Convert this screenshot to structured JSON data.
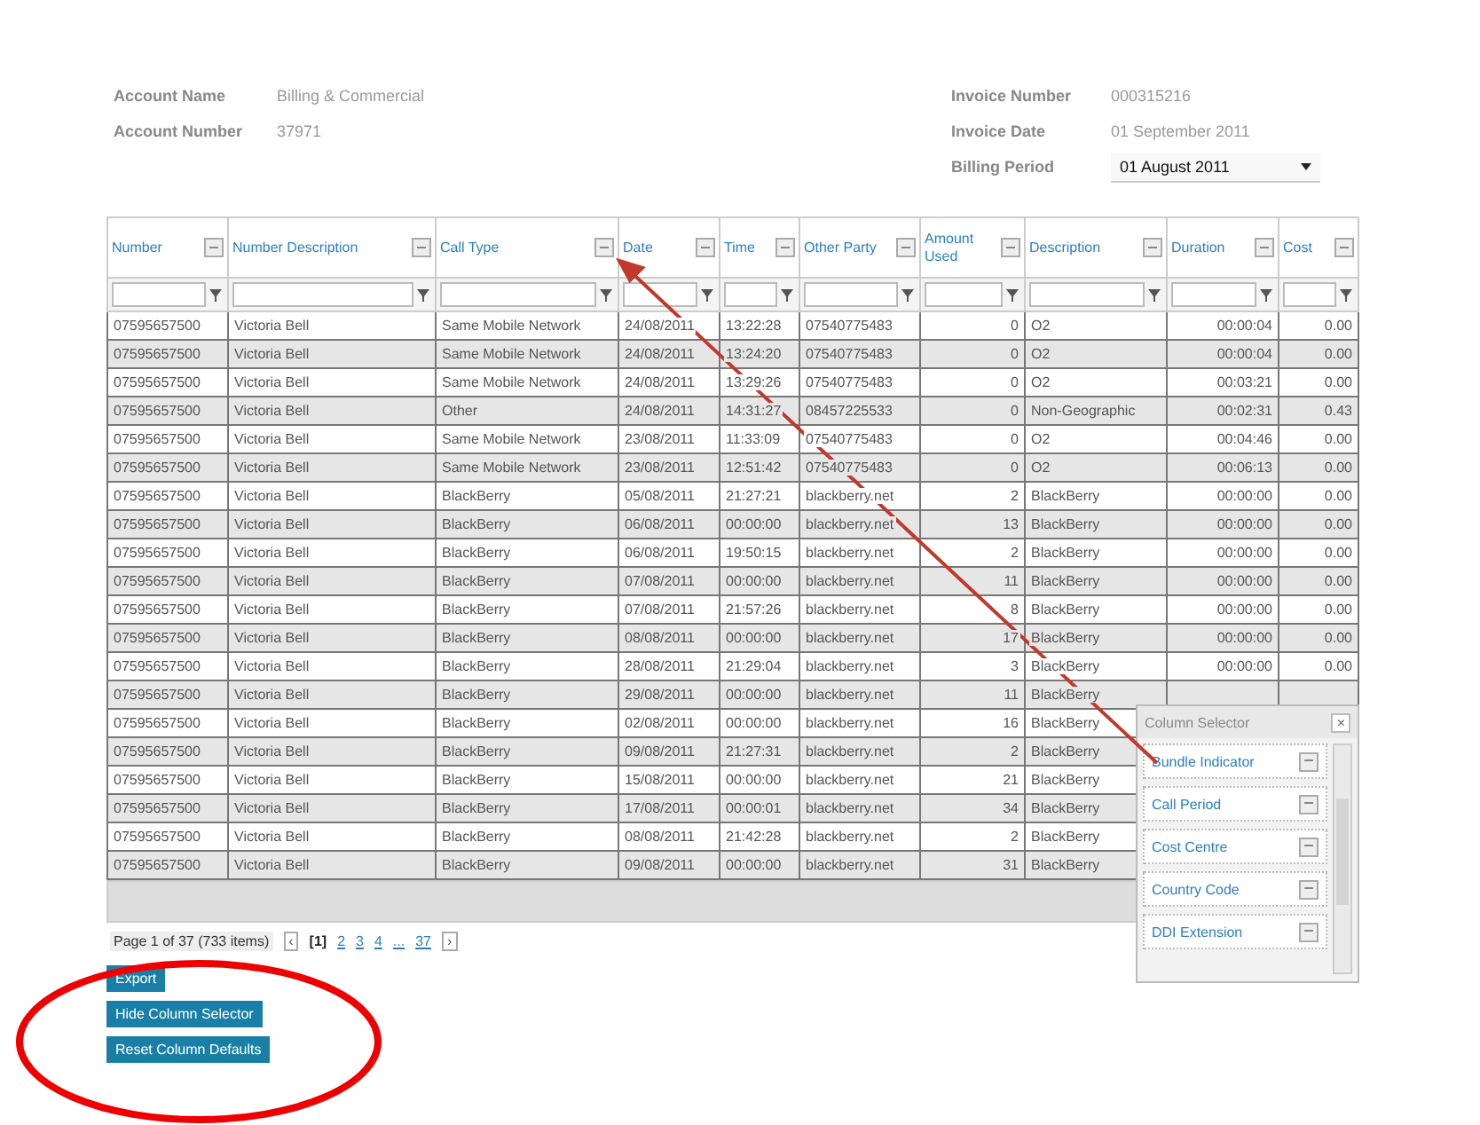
{
  "account": {
    "name_label": "Account Name",
    "name_value": "Billing & Commercial",
    "number_label": "Account Number",
    "number_value": "37971"
  },
  "invoice": {
    "number_label": "Invoice Number",
    "number_value": "000315216",
    "date_label": "Invoice Date",
    "date_value": "01 September 2011",
    "period_label": "Billing Period",
    "period_value": "01 August 2011"
  },
  "grid": {
    "columns": [
      {
        "label": "Number"
      },
      {
        "label": "Number Description"
      },
      {
        "label": "Call Type"
      },
      {
        "label": "Date"
      },
      {
        "label": "Time"
      },
      {
        "label": "Other Party"
      },
      {
        "label": "Amount Used"
      },
      {
        "label": "Description"
      },
      {
        "label": "Duration"
      },
      {
        "label": "Cost"
      }
    ],
    "rows": [
      {
        "cells": [
          "07595657500",
          "Victoria Bell",
          "Same Mobile Network",
          "24/08/2011",
          "13:22:28",
          "07540775483",
          "0",
          "O2",
          "00:00:04",
          "0.00"
        ]
      },
      {
        "cells": [
          "07595657500",
          "Victoria Bell",
          "Same Mobile Network",
          "24/08/2011",
          "13:24:20",
          "07540775483",
          "0",
          "O2",
          "00:00:04",
          "0.00"
        ]
      },
      {
        "cells": [
          "07595657500",
          "Victoria Bell",
          "Same Mobile Network",
          "24/08/2011",
          "13:29:26",
          "07540775483",
          "0",
          "O2",
          "00:03:21",
          "0.00"
        ]
      },
      {
        "cells": [
          "07595657500",
          "Victoria Bell",
          "Other",
          "24/08/2011",
          "14:31:27",
          "08457225533",
          "0",
          "Non-Geographic",
          "00:02:31",
          "0.43"
        ]
      },
      {
        "cells": [
          "07595657500",
          "Victoria Bell",
          "Same Mobile Network",
          "23/08/2011",
          "11:33:09",
          "07540775483",
          "0",
          "O2",
          "00:04:46",
          "0.00"
        ]
      },
      {
        "cells": [
          "07595657500",
          "Victoria Bell",
          "Same Mobile Network",
          "23/08/2011",
          "12:51:42",
          "07540775483",
          "0",
          "O2",
          "00:06:13",
          "0.00"
        ]
      },
      {
        "cells": [
          "07595657500",
          "Victoria Bell",
          "BlackBerry",
          "05/08/2011",
          "21:27:21",
          "blackberry.net",
          "2",
          "BlackBerry",
          "00:00:00",
          "0.00"
        ]
      },
      {
        "cells": [
          "07595657500",
          "Victoria Bell",
          "BlackBerry",
          "06/08/2011",
          "00:00:00",
          "blackberry.net",
          "13",
          "BlackBerry",
          "00:00:00",
          "0.00"
        ]
      },
      {
        "cells": [
          "07595657500",
          "Victoria Bell",
          "BlackBerry",
          "06/08/2011",
          "19:50:15",
          "blackberry.net",
          "2",
          "BlackBerry",
          "00:00:00",
          "0.00"
        ]
      },
      {
        "cells": [
          "07595657500",
          "Victoria Bell",
          "BlackBerry",
          "07/08/2011",
          "00:00:00",
          "blackberry.net",
          "11",
          "BlackBerry",
          "00:00:00",
          "0.00"
        ]
      },
      {
        "cells": [
          "07595657500",
          "Victoria Bell",
          "BlackBerry",
          "07/08/2011",
          "21:57:26",
          "blackberry.net",
          "8",
          "BlackBerry",
          "00:00:00",
          "0.00"
        ]
      },
      {
        "cells": [
          "07595657500",
          "Victoria Bell",
          "BlackBerry",
          "08/08/2011",
          "00:00:00",
          "blackberry.net",
          "17",
          "BlackBerry",
          "00:00:00",
          "0.00"
        ]
      },
      {
        "cells": [
          "07595657500",
          "Victoria Bell",
          "BlackBerry",
          "28/08/2011",
          "21:29:04",
          "blackberry.net",
          "3",
          "BlackBerry",
          "00:00:00",
          "0.00"
        ]
      },
      {
        "cells": [
          "07595657500",
          "Victoria Bell",
          "BlackBerry",
          "29/08/2011",
          "00:00:00",
          "blackberry.net",
          "11",
          "BlackBerry"
        ]
      },
      {
        "cells": [
          "07595657500",
          "Victoria Bell",
          "BlackBerry",
          "02/08/2011",
          "00:00:00",
          "blackberry.net",
          "16",
          "BlackBerry"
        ]
      },
      {
        "cells": [
          "07595657500",
          "Victoria Bell",
          "BlackBerry",
          "09/08/2011",
          "21:27:31",
          "blackberry.net",
          "2",
          "BlackBerry"
        ]
      },
      {
        "cells": [
          "07595657500",
          "Victoria Bell",
          "BlackBerry",
          "15/08/2011",
          "00:00:00",
          "blackberry.net",
          "21",
          "BlackBerry"
        ]
      },
      {
        "cells": [
          "07595657500",
          "Victoria Bell",
          "BlackBerry",
          "17/08/2011",
          "00:00:01",
          "blackberry.net",
          "34",
          "BlackBerry"
        ]
      },
      {
        "cells": [
          "07595657500",
          "Victoria Bell",
          "BlackBerry",
          "08/08/2011",
          "21:42:28",
          "blackberry.net",
          "2",
          "BlackBerry"
        ]
      },
      {
        "cells": [
          "07595657500",
          "Victoria Bell",
          "BlackBerry",
          "09/08/2011",
          "00:00:00",
          "blackberry.net",
          "31",
          "BlackBerry"
        ]
      }
    ]
  },
  "column_selector": {
    "title": "Column Selector",
    "close": "×",
    "items": [
      {
        "label": "Bundle Indicator"
      },
      {
        "label": "Call Period"
      },
      {
        "label": "Cost Centre"
      },
      {
        "label": "Country Code"
      },
      {
        "label": "DDI Extension"
      }
    ]
  },
  "pager": {
    "summary": "Page 1 of 37 (733 items)",
    "prev": "‹",
    "pages": [
      {
        "label": "[1]",
        "selected": true
      },
      {
        "label": "2",
        "selected": false
      },
      {
        "label": "3",
        "selected": false
      },
      {
        "label": "4",
        "selected": false
      },
      {
        "label": "...",
        "selected": false
      },
      {
        "label": "37",
        "selected": false
      }
    ],
    "next": "›"
  },
  "buttons": [
    {
      "label": "Export"
    },
    {
      "label": "Hide Column Selector"
    },
    {
      "label": "Reset Column Defaults"
    }
  ]
}
